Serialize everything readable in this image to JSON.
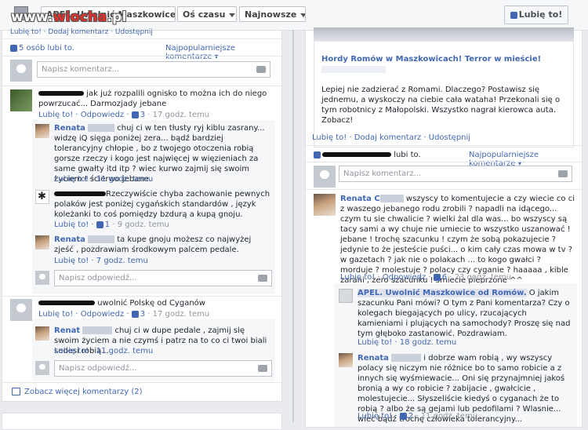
{
  "watermark": {
    "prefix": "www.",
    "brand": "wiocha",
    "suffix": ".pl"
  },
  "header": {
    "page_title": "APEL. Uwolnić Maszkowice ...",
    "filter_time": "Oś czasu",
    "filter_sort": "Najnowsze",
    "like_button": "Lubię to!"
  },
  "left": {
    "top_actions": "Lubię to! · Dodaj komentarz · Udostępnij",
    "likes": "5 osób lubi to.",
    "sort_label": "Najpopularniejsze komentarze",
    "comment_placeholder": "Napisz komentarz...",
    "reply_placeholder": "Napisz odpowiedź...",
    "c1": {
      "text": "jak już rozpalili ognisko to można ich do niego powrzucać... Darmozjady jebane",
      "meta": "Lubię to! · Odpowiedz · ",
      "likes": "3",
      "time": " · 17 godz. temu"
    },
    "r1": {
      "name": "Renata",
      "text": "chuj ci w ten tłusty ryj kiblu zasrany... widzę iQ sięga poniżej zera... bądź bardziej tolerancyjny chłopie , bo z twojego otoczenia robią gorsze rzeczy i kogo jest najwięcej w więzieniach za same gwałty itd itp ? wiec kurwo zajmij się swoim życiem ! ścierwo jebane.",
      "meta": "Lubię to! · 11 godz. temu"
    },
    "r2": {
      "text": "Rzeczywiście chyba zachowanie pewnych polaków jest poniżej cygańskich standardów , język koleżanki to coś pomiędzy bzdurą a kupą gnoju.",
      "meta": "Lubię to! · ",
      "likes": "1",
      "time": " · 9 godz. temu"
    },
    "r3": {
      "name": "Renata",
      "text": "ta kupe gnoju możesz co najwyżej zjeść , pozdrawiam środkowym palcem pedale.",
      "meta": "Lubię to! · 7 godz. temu"
    },
    "c2": {
      "text": "uwolnić Polskę od Cyganów",
      "meta": "Lubię to! · Odpowiedz · ",
      "likes": "3",
      "time": " · 17 godz. temu"
    },
    "r4": {
      "name": "Renat",
      "text": "chuj ci w dupe pedale , zajmij się swoim życiem a nie czymś i patrz na to co ci twoi biali sedesi robią...",
      "meta": "Lubię to! · 11 godz. temu"
    },
    "more": "Zobacz więcej komentarzy (2)"
  },
  "right": {
    "link_title": "Hordy Romów w Maszkowicach! Terror w mieście!",
    "link_desc": "Lepiej nie zadzierać z Romami. Dlaczego? Postawisz się jednemu, a wyskoczy na ciebie cała wataha! Przekonali się o tym robotnicy z Małopolski. Wszystko nagrał kierowca auta. Zobacz!",
    "actions": "Lubię to! · Dodaj komentarz · Udostępnij",
    "likes_suffix": "lubi to.",
    "sort_label": "Najpopularniejsze komentarze",
    "comment_placeholder": "Napisz komentarz...",
    "c1": {
      "name": "Renata C",
      "text": "wszyscy to komentujecie a czy wiecie co ci z waszego jebanego rodu zrobili ? napadli na idącego... czym tu sie chwalicie ? wielki żal dla was... bo wszyscy są tacy sami a wy chuje nie umiecie to wszystko uszanować ! jebane ! trochę szacunku ! czym że sobą pokazujecie ? jedynie to że jesteście puści... o kim cały czas mowa w tv ? w gazetach ? jak nie o polakach ... to kogo gwałci ? morduje ? molestuje ? polacy czy cyganie ? haaaaa , kible zarani , zero szacunku ! śmiecie pieprzone ^^",
      "meta": "Lubię to! · Odpowiedz · ",
      "likes": "6",
      "time": " · 23 godz. temu"
    },
    "r1": {
      "name": "APEL. Uwolnić Maszkowice od Romów.",
      "text": "O jakim szacunku Pani mówi? O tym z Pani komentarza? Czy o kolegach biegających po ulicy, rzucających kamieniami i plujących na samochody? Proszę się nad tym głęboko zastanowić. Pozdrawiam.",
      "meta": "Lubię to! · 18 godz. temu"
    },
    "r2": {
      "name": "Renata",
      "text": "i dobrze wam robią , wy wszyscy polacy się niczym nie różnice bo to samo robicie a z innych się wyśmiewacie... Oni się przynajmniej jakoś bronią a wy co robicie ? zabijacie , gwałcicie , molestujecie... Słyszeliście kiedyś o cyganach że to robią ? albo że są gejami lub pedofilami ? Wlasnie... wiec bądź trochę człowieka tolerancyjny...",
      "meta": "Lubię to! · ",
      "likes": "2",
      "time": " · 11 godz. temu"
    }
  }
}
